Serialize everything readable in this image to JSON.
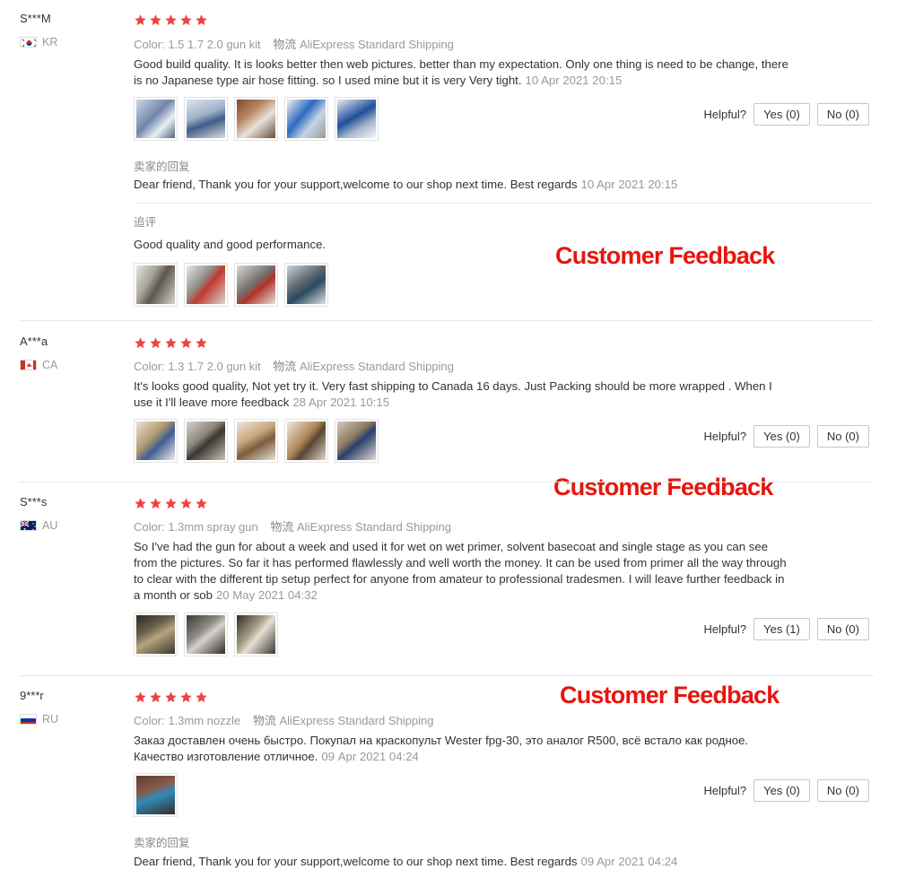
{
  "reviews": [
    {
      "user": "S***M",
      "country": "KR",
      "attr_label": "Color:",
      "attr_value": "1.5 1.7 2.0 gun kit",
      "ship_label": "物流",
      "ship_value": "AliExpress Standard Shipping",
      "text": "Good build quality. It is looks better then web pictures. better than my expectation. Only one thing is need to be change, there is no Japanese type air hose fitting. so I used mine but it is very Very tight.",
      "date": "10 Apr 2021 20:15",
      "helpful_label": "Helpful?",
      "yes_label": "Yes (0)",
      "no_label": "No (0)",
      "seller_reply_label": "卖家的回复",
      "seller_reply": "Dear friend, Thank you for your support,welcome to our shop next time. Best regards",
      "seller_reply_date": "10 Apr 2021 20:15",
      "additional_label": "追评",
      "additional_text": "Good quality and good performance."
    },
    {
      "user": "A***a",
      "country": "CA",
      "attr_label": "Color:",
      "attr_value": "1.3 1.7 2.0 gun kit",
      "ship_label": "物流",
      "ship_value": "AliExpress Standard Shipping",
      "text": "It's looks good quality, Not yet try it. Very fast shipping to Canada 16 days. Just Packing should be more wrapped . When I use it I'll leave more feedback",
      "date": "28 Apr 2021 10:15",
      "helpful_label": "Helpful?",
      "yes_label": "Yes (0)",
      "no_label": "No (0)"
    },
    {
      "user": "S***s",
      "country": "AU",
      "attr_label": "Color:",
      "attr_value": "1.3mm spray gun",
      "ship_label": "物流",
      "ship_value": "AliExpress Standard Shipping",
      "text": "So I've had the gun for about a week and used it for wet on wet primer, solvent basecoat and single stage as you can see from the pictures. So far it has performed flawlessly and well worth the money. It can be used from primer all the way through to clear with the different tip setup perfect for anyone from amateur to professional tradesmen. I will leave further feedback in a month or sob",
      "date": "20 May 2021 04:32",
      "helpful_label": "Helpful?",
      "yes_label": "Yes (1)",
      "no_label": "No (0)"
    },
    {
      "user": "9***r",
      "country": "RU",
      "attr_label": "Color:",
      "attr_value": "1.3mm nozzle",
      "ship_label": "物流",
      "ship_value": "AliExpress Standard Shipping",
      "text": "Заказ доставлен очень быстро. Покупал на краскопульт Wester fpg-30, это аналог R500, всё встало как родное. Качество изготовление отличное.",
      "date": "09 Apr 2021 04:24",
      "helpful_label": "Helpful?",
      "yes_label": "Yes (0)",
      "no_label": "No (0)",
      "seller_reply_label": "卖家的回复",
      "seller_reply": "Dear friend, Thank you for your support,welcome to our shop next time. Best regards",
      "seller_reply_date": "09 Apr 2021 04:24"
    }
  ],
  "promo_label": "Customer Feedback",
  "colors": {
    "star": "#f0433e",
    "promo": "#e8150d",
    "muted": "#999999"
  }
}
